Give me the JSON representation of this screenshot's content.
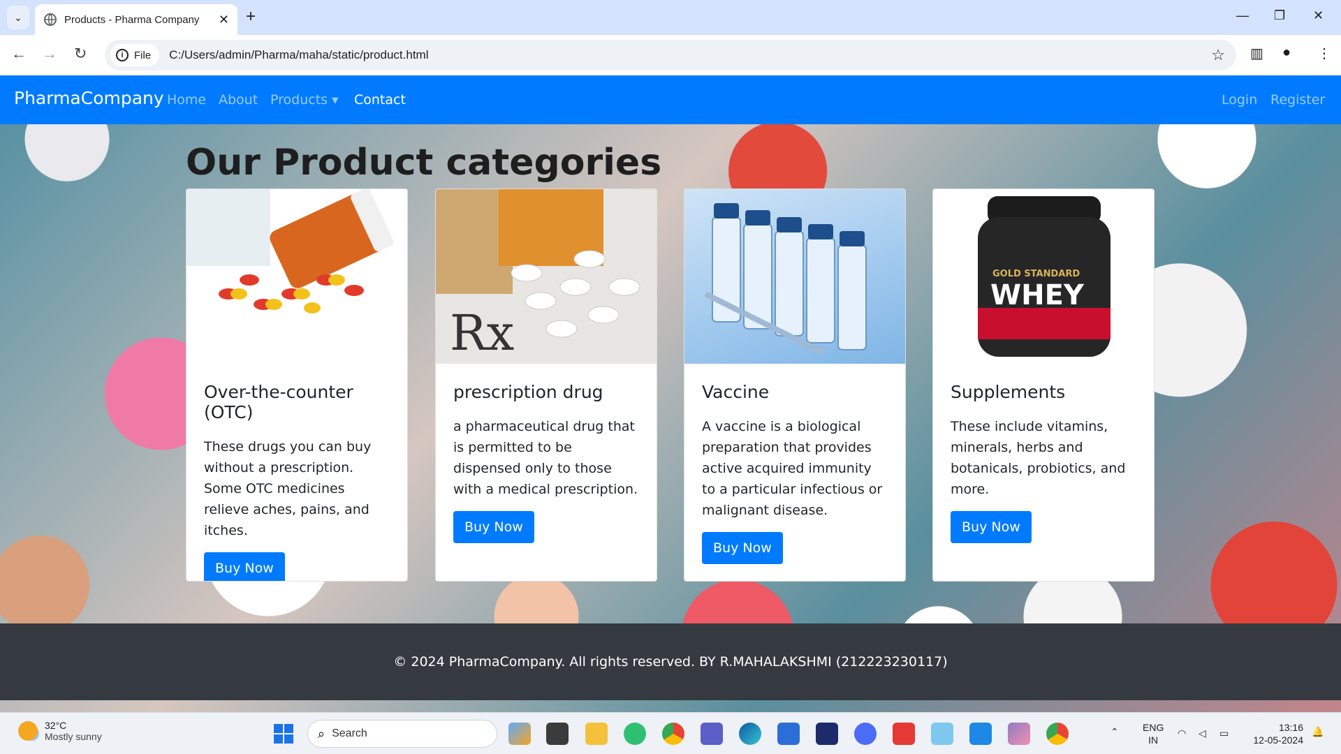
{
  "browser": {
    "tab_title": "Products - Pharma Company",
    "file_chip": "File",
    "url": "C:/Users/admin/Pharma/maha/static/product.html"
  },
  "navbar": {
    "brand": "PharmaCompany",
    "links": [
      "Home",
      "About",
      "Products",
      "Contact"
    ],
    "right_links": [
      "Login",
      "Register"
    ]
  },
  "section_title": "Our Product categories",
  "cards": [
    {
      "title": "Over-the-counter (OTC)",
      "text": "These drugs you can buy without a prescription. Some OTC medicines relieve aches, pains, and itches.",
      "button": "Buy Now"
    },
    {
      "title": "prescription drug",
      "text": "a pharmaceutical drug that is permitted to be dispensed only to those with a medical prescription.",
      "button": "Buy Now"
    },
    {
      "title": "Vaccine",
      "text": "A vaccine is a biological preparation that provides active acquired immunity to a particular infectious or malignant disease.",
      "button": "Buy Now"
    },
    {
      "title": "Supplements",
      "text": "These include vitamins, minerals, herbs and botanicals, probiotics, and more.",
      "button": "Buy Now"
    }
  ],
  "footer": "© 2024 PharmaCompany. All rights reserved. BY R.MAHALAKSHMI (212223230117)",
  "taskbar": {
    "temperature": "32°C",
    "weather": "Mostly sunny",
    "search": "Search",
    "lang1": "ENG",
    "lang2": "IN",
    "time": "13:16",
    "date": "12-05-2024"
  },
  "colors": {
    "primary": "#007bff",
    "footer_bg": "#343a40",
    "tabstrip": "#d3e3fd"
  }
}
